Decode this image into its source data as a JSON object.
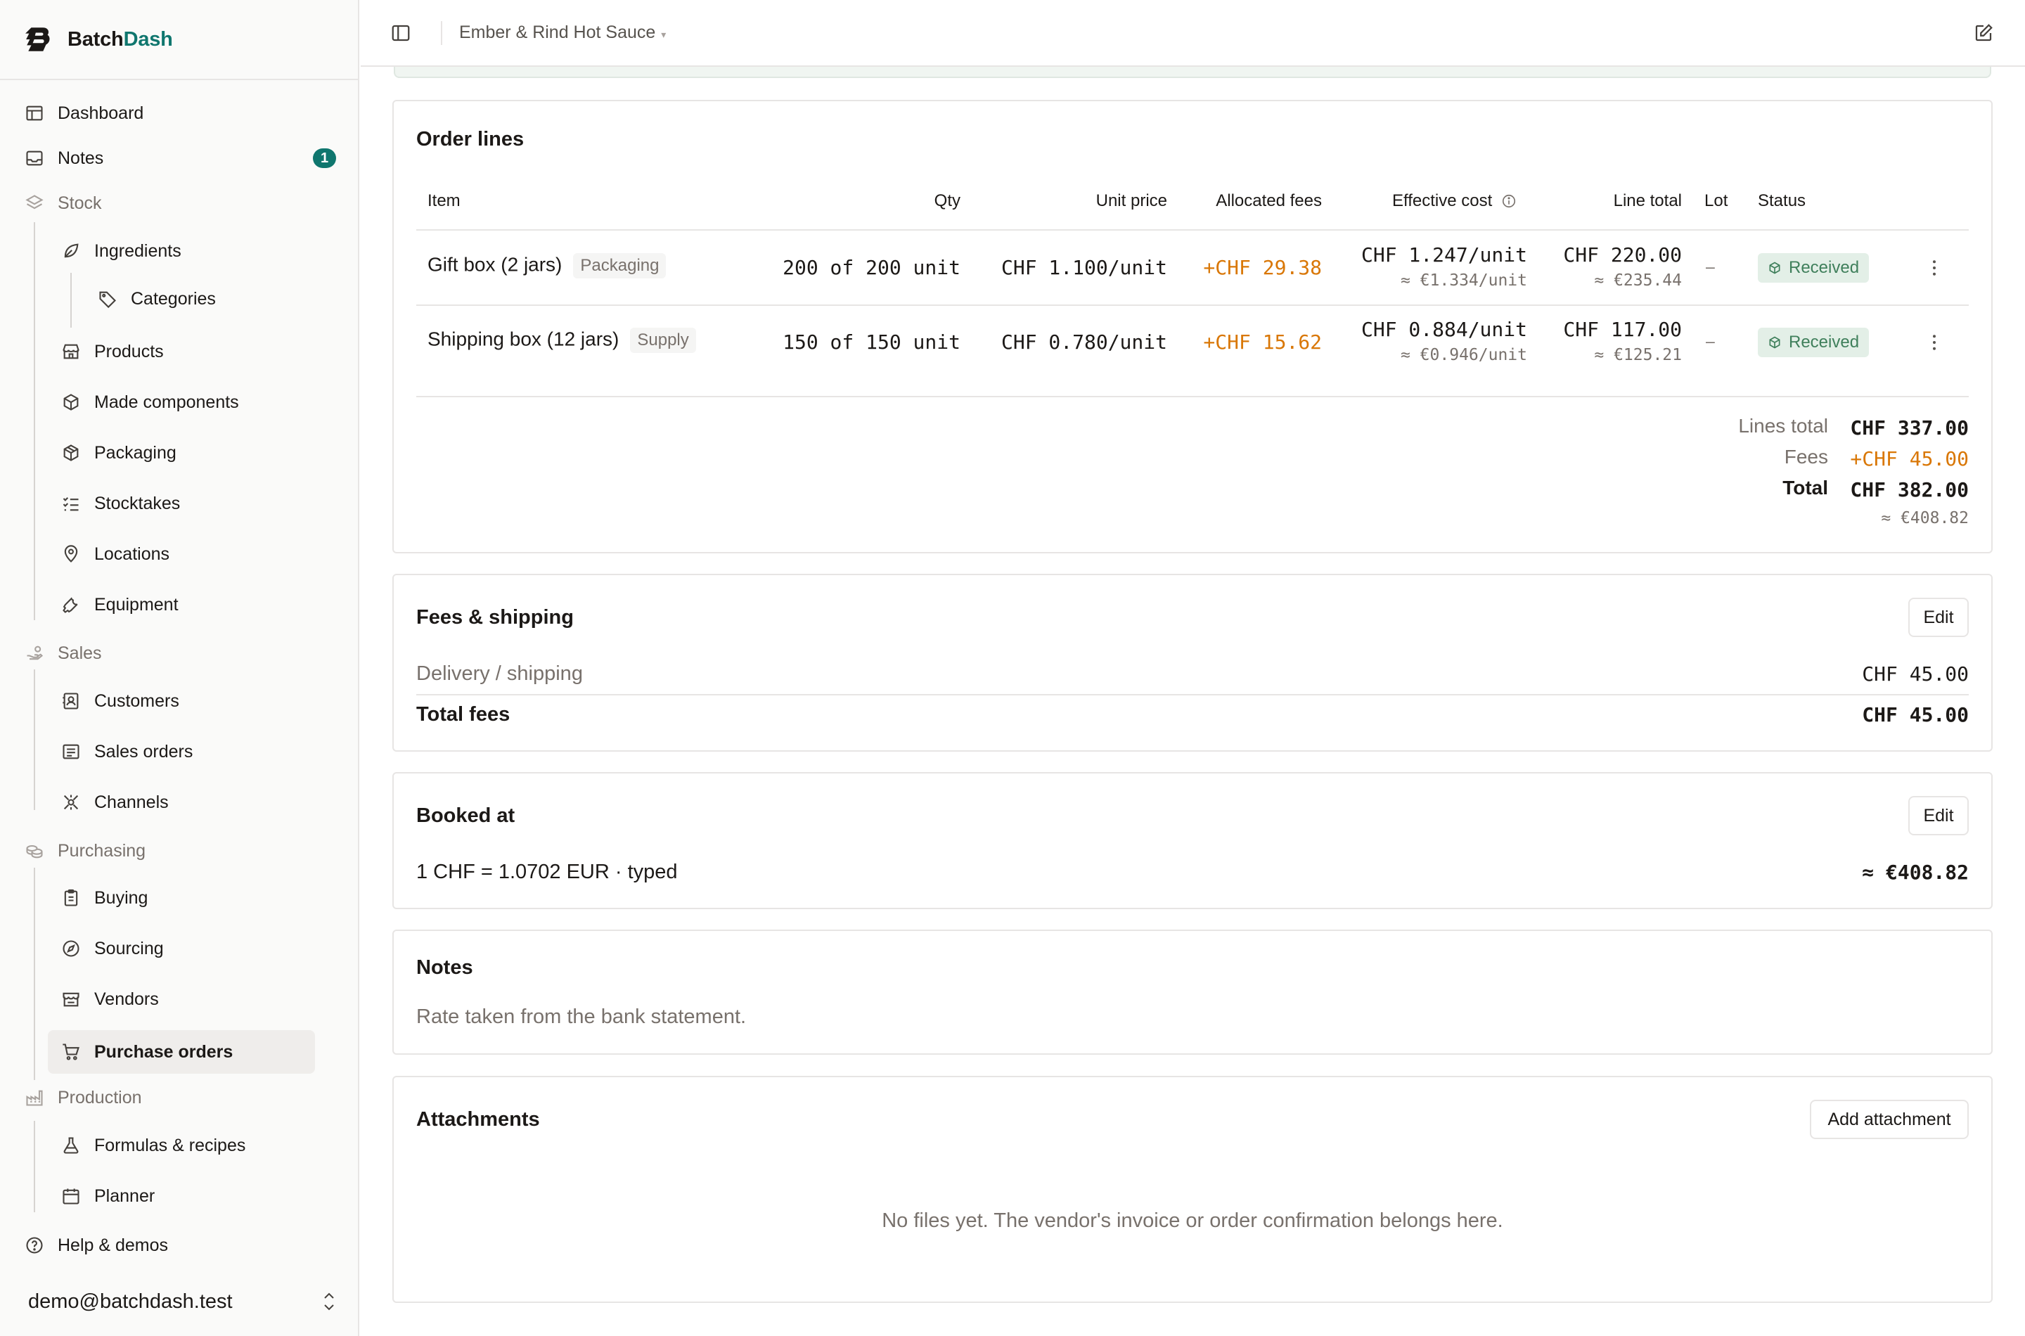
{
  "app": {
    "brand_a": "Batch",
    "brand_b": "Dash",
    "accent": "#0f766e"
  },
  "topbar": {
    "title": "Ember & Rind Hot Sauce",
    "caret": "▾"
  },
  "sidebar": {
    "dashboard": "Dashboard",
    "notes": "Notes",
    "notes_count": "1",
    "stock": "Stock",
    "ingredients": "Ingredients",
    "categories": "Categories",
    "products": "Products",
    "made_components": "Made components",
    "packaging": "Packaging",
    "stocktakes": "Stocktakes",
    "locations": "Locations",
    "equipment": "Equipment",
    "sales": "Sales",
    "customers": "Customers",
    "sales_orders": "Sales orders",
    "channels": "Channels",
    "purchasing": "Purchasing",
    "buying": "Buying",
    "sourcing": "Sourcing",
    "vendors": "Vendors",
    "purchase_orders": "Purchase orders",
    "production": "Production",
    "formulas": "Formulas & recipes",
    "planner": "Planner",
    "help": "Help & demos",
    "user": "demo@batchdash.test"
  },
  "order_lines": {
    "title": "Order lines",
    "headers": {
      "item": "Item",
      "qty": "Qty",
      "unit_price": "Unit price",
      "allocated_fees": "Allocated fees",
      "effective_cost": "Effective cost",
      "line_total": "Line total",
      "lot": "Lot",
      "status": "Status"
    },
    "rows": [
      {
        "item": "Gift box (2 jars)",
        "tag": "Packaging",
        "qty": "200 of 200 unit",
        "unit_price": "CHF 1.100/unit",
        "fees": "+CHF 29.38",
        "eff": "CHF 1.247/unit",
        "eff_sub": "≈ €1.334/unit",
        "total": "CHF 220.00",
        "total_sub": "≈ €235.44",
        "lot": "–",
        "status": "Received"
      },
      {
        "item": "Shipping box (12 jars)",
        "tag": "Supply",
        "qty": "150 of 150 unit",
        "unit_price": "CHF 0.780/unit",
        "fees": "+CHF 15.62",
        "eff": "CHF 0.884/unit",
        "eff_sub": "≈ €0.946/unit",
        "total": "CHF 117.00",
        "total_sub": "≈ €125.21",
        "lot": "–",
        "status": "Received"
      }
    ],
    "summary": {
      "lines_total_label": "Lines total",
      "lines_total": "CHF 337.00",
      "fees_label": "Fees",
      "fees": "+CHF 45.00",
      "total_label": "Total",
      "total": "CHF 382.00",
      "total_sub": "≈ €408.82"
    }
  },
  "fees": {
    "title": "Fees & shipping",
    "edit": "Edit",
    "delivery_label": "Delivery / shipping",
    "delivery_value": "CHF 45.00",
    "total_label": "Total fees",
    "total_value": "CHF 45.00"
  },
  "booked": {
    "title": "Booked at",
    "edit": "Edit",
    "rate": "1 CHF = 1.0702 EUR · typed",
    "value": "≈ €408.82"
  },
  "notes": {
    "title": "Notes",
    "text": "Rate taken from the bank statement."
  },
  "attachments": {
    "title": "Attachments",
    "add": "Add attachment",
    "empty": "No files yet. The vendor's invoice or order confirmation belongs here."
  }
}
